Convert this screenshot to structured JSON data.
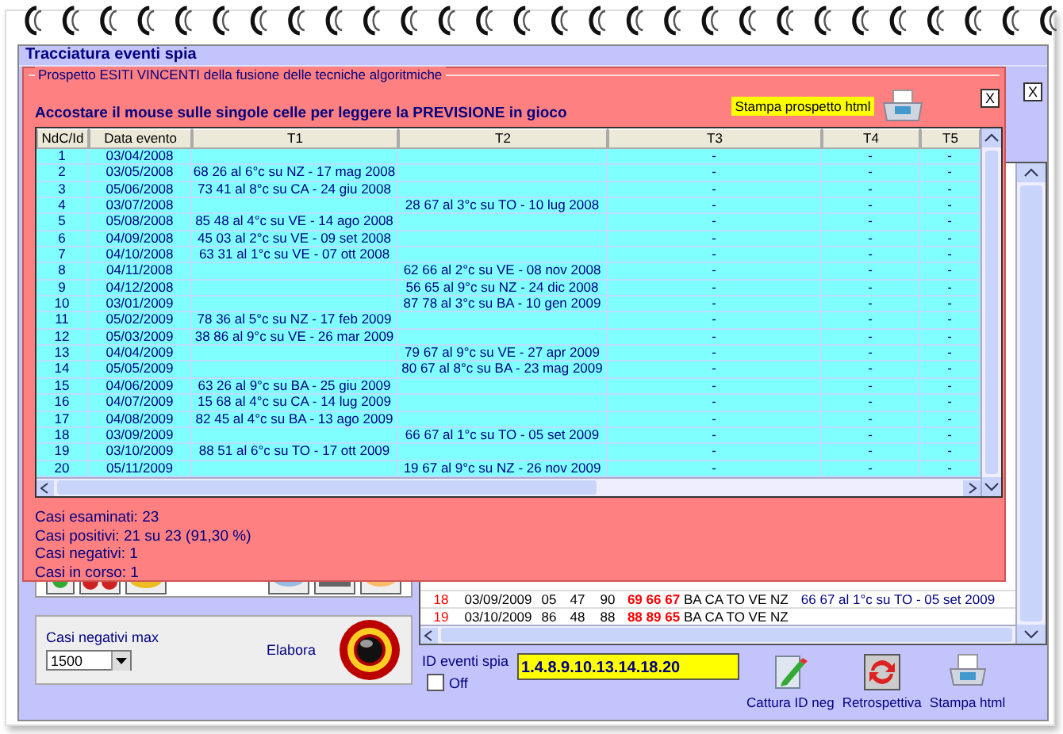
{
  "window": {
    "title": "Tracciatura eventi spia",
    "close": "X"
  },
  "dialog": {
    "title": "Prospetto ESITI VINCENTI della fusione delle tecniche algoritmiche",
    "close": "X",
    "heading": "Accostare il mouse sulle singole celle per leggere la PREVISIONE in gioco",
    "print_label": "Stampa prospetto html",
    "columns": [
      "NdC/Id",
      "Data evento",
      "T1",
      "T2",
      "T3",
      "T4",
      "T5"
    ],
    "rows": [
      {
        "id": "1",
        "date": "03/04/2008",
        "t3": "-",
        "t4": "-",
        "t5": "-"
      },
      {
        "id": "2",
        "date": "03/05/2008",
        "t1": "68 26 al 6°c su NZ - 17 mag 2008",
        "t3": "-",
        "t4": "-",
        "t5": "-"
      },
      {
        "id": "3",
        "date": "05/06/2008",
        "t1": "73 41 al 8°c su CA - 24 giu 2008",
        "t3": "-",
        "t4": "-",
        "t5": "-"
      },
      {
        "id": "4",
        "date": "03/07/2008",
        "t2": "28 67 al 3°c su TO - 10 lug 2008",
        "t3": "-",
        "t4": "-",
        "t5": "-"
      },
      {
        "id": "5",
        "date": "05/08/2008",
        "t1": "85 48 al 4°c su VE - 14 ago 2008",
        "t3": "-",
        "t4": "-",
        "t5": "-"
      },
      {
        "id": "6",
        "date": "04/09/2008",
        "t1": "45 03 al 2°c su VE - 09 set 2008",
        "t3": "-",
        "t4": "-",
        "t5": "-"
      },
      {
        "id": "7",
        "date": "04/10/2008",
        "t1": "63 31 al 1°c su VE - 07 ott 2008",
        "t3": "-",
        "t4": "-",
        "t5": "-"
      },
      {
        "id": "8",
        "date": "04/11/2008",
        "t2": "62 66 al 2°c su VE - 08 nov 2008",
        "t3": "-",
        "t4": "-",
        "t5": "-"
      },
      {
        "id": "9",
        "date": "04/12/2008",
        "t2": "56 65 al 9°c su NZ - 24 dic 2008",
        "t3": "-",
        "t4": "-",
        "t5": "-"
      },
      {
        "id": "10",
        "date": "03/01/2009",
        "t2": "87 78 al 3°c su BA - 10 gen 2009",
        "t3": "-",
        "t4": "-",
        "t5": "-"
      },
      {
        "id": "11",
        "date": "05/02/2009",
        "t1": "78 36 al 5°c su NZ - 17 feb 2009",
        "t3": "-",
        "t4": "-",
        "t5": "-"
      },
      {
        "id": "12",
        "date": "05/03/2009",
        "t1": "38 86 al 9°c su VE - 26 mar 2009",
        "t3": "-",
        "t4": "-",
        "t5": "-"
      },
      {
        "id": "13",
        "date": "04/04/2009",
        "t2": "79 67 al 9°c su VE - 27 apr 2009",
        "t3": "-",
        "t4": "-",
        "t5": "-"
      },
      {
        "id": "14",
        "date": "05/05/2009",
        "t2": "80 67 al 8°c su BA - 23 mag 2009",
        "t3": "-",
        "t4": "-",
        "t5": "-"
      },
      {
        "id": "15",
        "date": "04/06/2009",
        "t1": "63 26 al 9°c su BA - 25 giu 2009",
        "t3": "-",
        "t4": "-",
        "t5": "-"
      },
      {
        "id": "16",
        "date": "04/07/2009",
        "t1": "15 68 al 4°c su CA - 14 lug 2009",
        "t3": "-",
        "t4": "-",
        "t5": "-"
      },
      {
        "id": "17",
        "date": "04/08/2009",
        "t1": "82 45 al 4°c su BA - 13 ago 2009",
        "t3": "-",
        "t4": "-",
        "t5": "-"
      },
      {
        "id": "18",
        "date": "03/09/2009",
        "t2": "66 67 al 1°c su TO - 05 set 2009",
        "t3": "-",
        "t4": "-",
        "t5": "-"
      },
      {
        "id": "19",
        "date": "03/10/2009",
        "t1": "88 51 al 6°c su TO - 17 ott 2009",
        "t3": "-",
        "t4": "-",
        "t5": "-"
      },
      {
        "id": "20",
        "date": "05/11/2009",
        "t2": "19 67 al 9°c su NZ - 26 nov 2009",
        "t3": "-",
        "t4": "-",
        "t5": "-"
      }
    ],
    "summary": [
      "Casi esaminati: 23",
      "Casi positivi: 21 su 23 (91,30 %)",
      "Casi negativi: 1",
      "Casi in corso: 1"
    ]
  },
  "background_table": {
    "rows": [
      {
        "cells": [
          "18",
          "03/09/2009",
          "05",
          "47",
          "90",
          "69 66 67",
          "BA CA TO VE NZ",
          "66 67 al 1°c su TO - 05 set 2009"
        ]
      },
      {
        "cells": [
          "19",
          "03/10/2009",
          "86",
          "48",
          "88",
          "88 89 65",
          "BA CA TO VE NZ"
        ]
      }
    ]
  },
  "negative_max": {
    "label": "Casi negativi max",
    "value": "1500"
  },
  "run_label": "Elabora",
  "id_field": {
    "label": "ID eventi spia",
    "value": "1.4.8.9.10.13.14.18.20"
  },
  "off": {
    "label": "Off",
    "checked": false
  },
  "buttons": [
    {
      "label": "Cattura ID neg",
      "kind": "edit"
    },
    {
      "label": "Retrospettiva",
      "kind": "refresh"
    },
    {
      "label": "Stampa html",
      "kind": "print"
    }
  ]
}
